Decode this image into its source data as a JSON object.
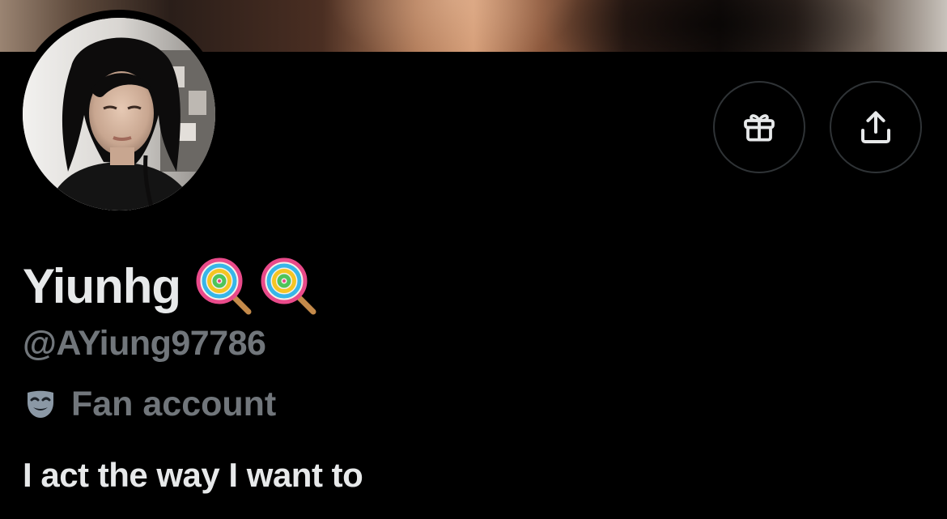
{
  "profile": {
    "display_name": "Yiunhg",
    "name_emojis": [
      "lollipop-emoji",
      "lollipop-emoji"
    ],
    "handle": "@AYiung97786",
    "category_icon": "performing-arts-mask-icon",
    "category": "Fan account",
    "bio": "I act the way I want to"
  },
  "actions": {
    "gift_icon": "gift-icon",
    "share_icon": "share-upload-icon"
  },
  "colors": {
    "background": "#000000",
    "primary_text": "#e7e9ea",
    "secondary_text": "#71767b",
    "button_border": "#2f3336"
  }
}
